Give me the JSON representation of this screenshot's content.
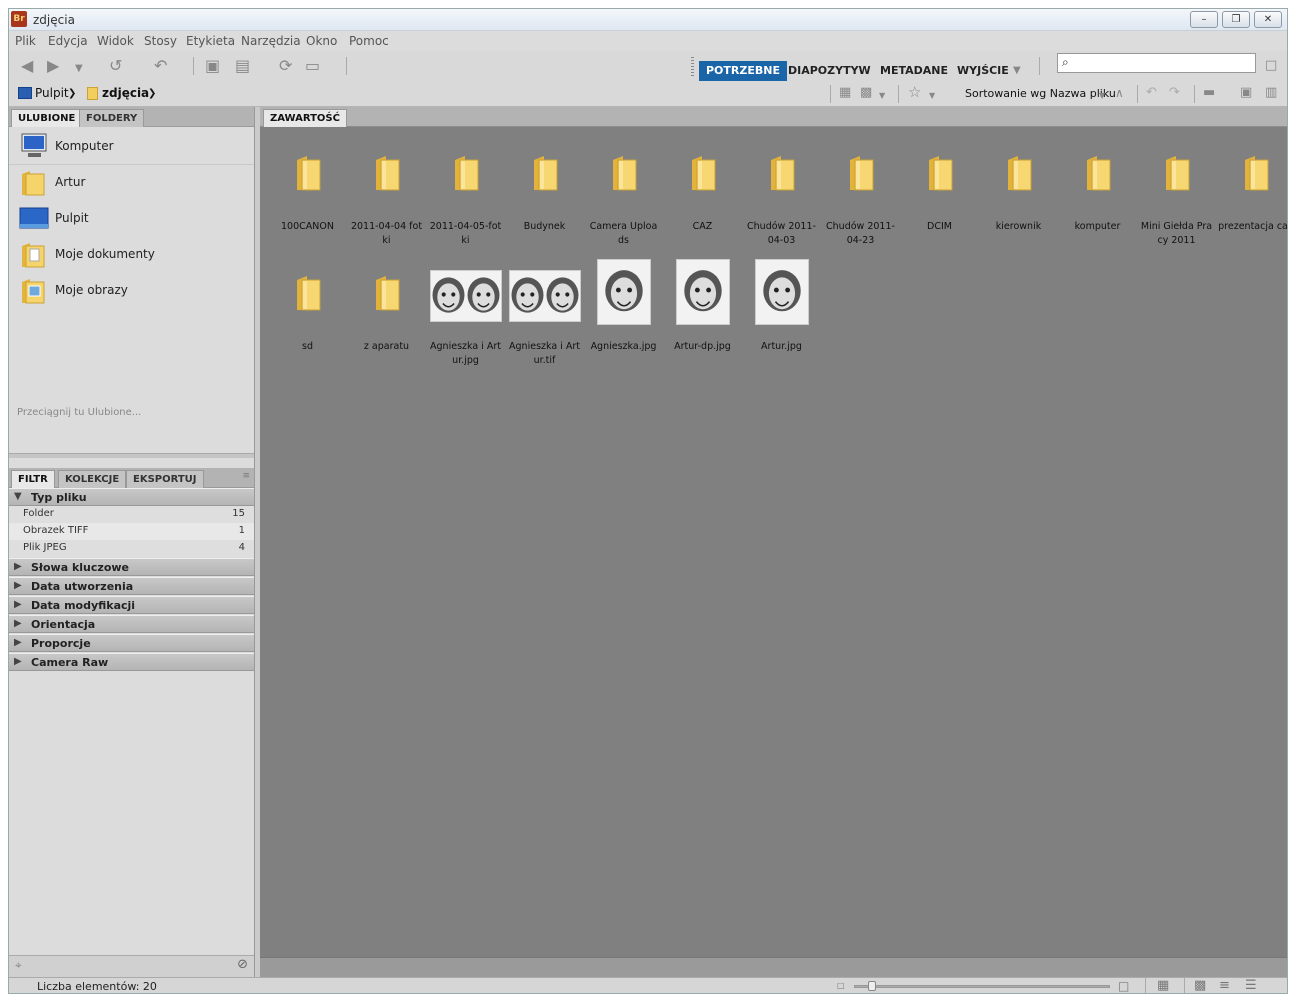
{
  "window": {
    "title": "zdjęcia",
    "app_logo": "Br"
  },
  "menu": [
    "Plik",
    "Edycja",
    "Widok",
    "Stosy",
    "Etykieta",
    "Narzędzia",
    "Okno",
    "Pomoc"
  ],
  "workspaces": [
    {
      "label": "POTRZEBNE",
      "active": true
    },
    {
      "label": "DIAPOZYTYW",
      "active": false
    },
    {
      "label": "METADANE",
      "active": false
    },
    {
      "label": "WYJŚCIE",
      "active": false
    }
  ],
  "search": {
    "placeholder": ""
  },
  "breadcrumb": [
    {
      "label": "Pulpit",
      "icon": "desktop-icon"
    },
    {
      "label": "zdjęcia",
      "icon": "folder-icon"
    }
  ],
  "sort": {
    "label": "Sortowanie wg Nazwa pliku"
  },
  "left_tabs": {
    "favorites": "ULUBIONE",
    "folders": "FOLDERY"
  },
  "favorites": [
    {
      "label": "Komputer",
      "icon": "computer-icon"
    },
    {
      "label": "Artur",
      "icon": "user-folder-icon"
    },
    {
      "label": "Pulpit",
      "icon": "desktop-icon"
    },
    {
      "label": "Moje dokumenty",
      "icon": "documents-icon"
    },
    {
      "label": "Moje obrazy",
      "icon": "pictures-icon"
    }
  ],
  "favorites_hint": "Przeciągnij tu Ulubione...",
  "filter_tabs": {
    "filter": "FILTR",
    "collections": "KOLEKCJE",
    "export": "EKSPORTUJ"
  },
  "filter": {
    "file_type": {
      "label": "Typ pliku",
      "rows": [
        {
          "label": "Folder",
          "count": "15"
        },
        {
          "label": "Obrazek TIFF",
          "count": "1"
        },
        {
          "label": "Plik JPEG",
          "count": "4"
        }
      ]
    },
    "sections": [
      "Słowa kluczowe",
      "Data utworzenia",
      "Data modyfikacji",
      "Orientacja",
      "Proporcje",
      "Camera Raw"
    ]
  },
  "content_tab": "ZAWARTOŚĆ",
  "items": [
    {
      "name": "100CANON",
      "type": "folder"
    },
    {
      "name": "2011-04-04 fot\nki",
      "type": "folder"
    },
    {
      "name": "2011-04-05-fot\nki",
      "type": "folder"
    },
    {
      "name": "Budynek",
      "type": "folder"
    },
    {
      "name": "Camera Uploa\nds",
      "type": "folder"
    },
    {
      "name": "CAZ",
      "type": "folder"
    },
    {
      "name": "Chudów 2011-\n04-03",
      "type": "folder"
    },
    {
      "name": "Chudów 2011-\n04-23",
      "type": "folder"
    },
    {
      "name": "DCIM",
      "type": "folder"
    },
    {
      "name": "kierownik",
      "type": "folder"
    },
    {
      "name": "komputer",
      "type": "folder"
    },
    {
      "name": "Mini Giełda Pra\ncy 2011",
      "type": "folder"
    },
    {
      "name": "prezentacja caz",
      "type": "folder"
    },
    {
      "name": "sd",
      "type": "folder"
    },
    {
      "name": "z aparatu",
      "type": "folder"
    },
    {
      "name": "Agnieszka i Art\nur.jpg",
      "type": "image-wide"
    },
    {
      "name": "Agnieszka i Art\nur.tif",
      "type": "image-wide"
    },
    {
      "name": "Agnieszka.jpg",
      "type": "image-tall"
    },
    {
      "name": "Artur-dp.jpg",
      "type": "image-tall"
    },
    {
      "name": "Artur.jpg",
      "type": "image-tall"
    }
  ],
  "status": {
    "item_count": "Liczba elementów: 20"
  },
  "colors": {
    "accent": "#1a64a8",
    "content_bg": "#808080",
    "panel_bg": "#dcdcdc"
  }
}
